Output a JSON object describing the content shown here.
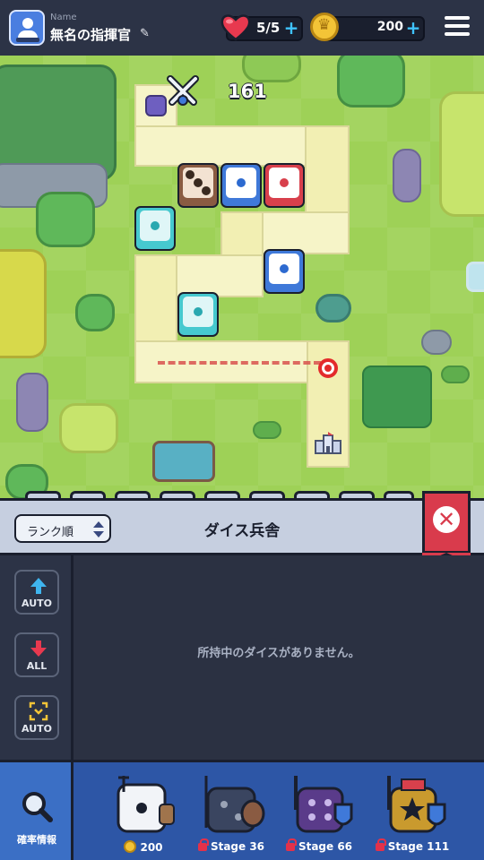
{
  "header": {
    "name_label": "Name",
    "name_value": "無名の指揮官",
    "hearts": "5/5",
    "coins": "200",
    "plus": "+"
  },
  "field": {
    "wave": "161"
  },
  "panel": {
    "sort_label": "ランク順",
    "title": "ダイス兵舎",
    "close": "✕",
    "auto_up_label": "AUTO",
    "all_down_label": "ALL",
    "auto_merge_label": "AUTO",
    "empty_message": "所持中のダイスがありません。"
  },
  "bottom": {
    "prob_label": "確率情報",
    "slots": [
      {
        "label": "200"
      },
      {
        "label": "Stage 36"
      },
      {
        "label": "Stage 66"
      },
      {
        "label": "Stage 111"
      }
    ]
  },
  "colors": {
    "dice_cyan": "#46c9cf",
    "dice_blue": "#3f79d9",
    "dice_red": "#d8404c",
    "dice_brown": "#8a5b42",
    "accent_close": "#d93b4c"
  }
}
